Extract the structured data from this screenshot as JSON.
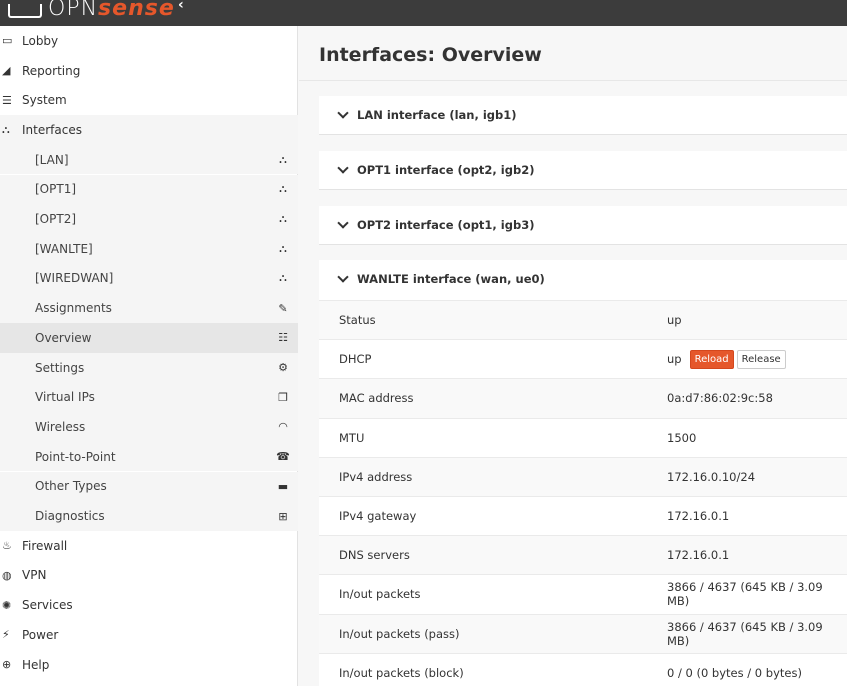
{
  "app": {
    "logo_opn": "OPN",
    "logo_sense": "sense",
    "collapse_glyph": "‹"
  },
  "sidebar": {
    "top_items": [
      {
        "label": "Lobby",
        "icon": "laptop-icon"
      },
      {
        "label": "Reporting",
        "icon": "area-chart-icon"
      },
      {
        "label": "System",
        "icon": "server-icon"
      },
      {
        "label": "Interfaces",
        "icon": "sitemap-icon"
      }
    ],
    "interface_items": [
      {
        "label": "[LAN]",
        "icon": "sitemap-icon"
      },
      {
        "label": "[OPT1]",
        "icon": "sitemap-icon"
      },
      {
        "label": "[OPT2]",
        "icon": "sitemap-icon"
      },
      {
        "label": "[WANLTE]",
        "icon": "sitemap-icon"
      },
      {
        "label": "[WIREDWAN]",
        "icon": "sitemap-icon"
      },
      {
        "label": "Assignments",
        "icon": "pencil-icon"
      },
      {
        "label": "Overview",
        "icon": "list-icon"
      },
      {
        "label": "Settings",
        "icon": "cogs-icon"
      },
      {
        "label": "Virtual IPs",
        "icon": "clone-icon"
      },
      {
        "label": "Wireless",
        "icon": "wifi-icon"
      },
      {
        "label": "Point-to-Point",
        "icon": "tty-icon"
      },
      {
        "label": "Other Types",
        "icon": "archive-icon"
      },
      {
        "label": "Diagnostics",
        "icon": "medkit-icon"
      }
    ],
    "bottom_items": [
      {
        "label": "Firewall",
        "icon": "fire-icon"
      },
      {
        "label": "VPN",
        "icon": "globe-icon"
      },
      {
        "label": "Services",
        "icon": "cog-icon"
      },
      {
        "label": "Power",
        "icon": "plug-icon"
      },
      {
        "label": "Help",
        "icon": "life-ring-icon"
      }
    ]
  },
  "main": {
    "title": "Interfaces: Overview",
    "panels": [
      {
        "title": "LAN interface (lan, igb1)"
      },
      {
        "title": "OPT1 interface (opt2, igb2)"
      },
      {
        "title": "OPT2 interface (opt1, igb3)"
      },
      {
        "title": "WANLTE interface (wan, ue0)"
      }
    ],
    "wan_rows": [
      {
        "key": "Status",
        "value": "up"
      },
      {
        "key": "DHCP",
        "value": "up"
      },
      {
        "key": "MAC address",
        "value": "0a:d7:86:02:9c:58"
      },
      {
        "key": "MTU",
        "value": "1500"
      },
      {
        "key": "IPv4 address",
        "value": "172.16.0.10/24"
      },
      {
        "key": "IPv4 gateway",
        "value": "172.16.0.1"
      },
      {
        "key": "DNS servers",
        "value": "172.16.0.1"
      },
      {
        "key": "In/out packets",
        "value": "3866 / 4637 (645 KB / 3.09 MB)"
      },
      {
        "key": "In/out packets (pass)",
        "value": "3866 / 4637 (645 KB / 3.09 MB)"
      },
      {
        "key": "In/out packets (block)",
        "value": "0 / 0 (0 bytes / 0 bytes)"
      }
    ],
    "dhcp_buttons": {
      "reload": "Reload",
      "release": "Release"
    }
  },
  "colors": {
    "accent": "#e5572b",
    "topbar": "#3c3c3c"
  }
}
